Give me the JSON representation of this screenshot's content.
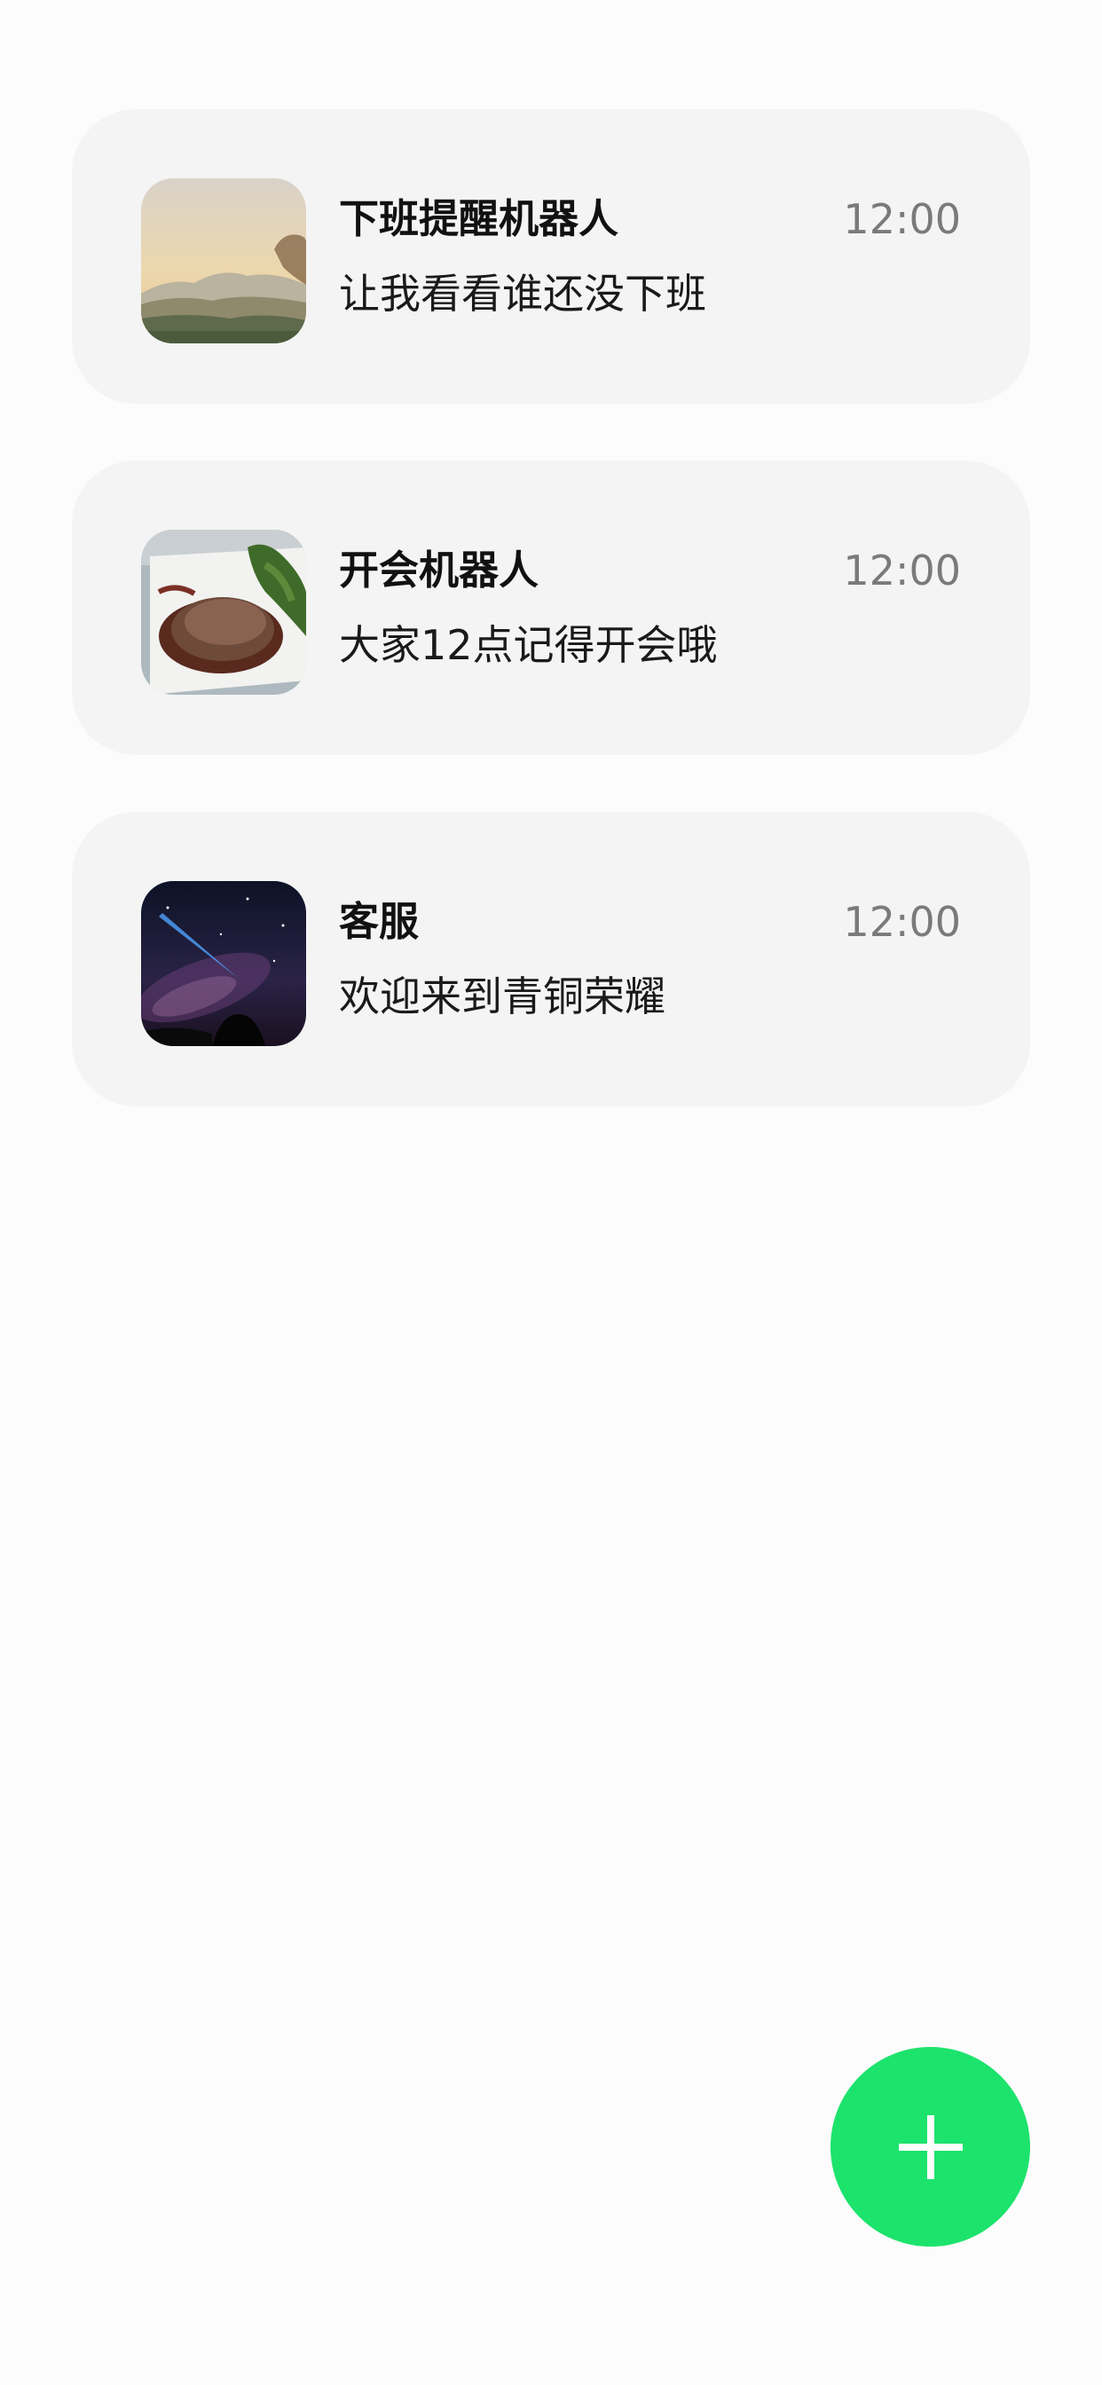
{
  "conversations": [
    {
      "title": "下班提醒机器人",
      "time": "12:00",
      "message": "让我看看谁还没下班",
      "avatar": "landscape-photo-avatar"
    },
    {
      "title": "开会机器人",
      "time": "12:00",
      "message": "大家12点记得开会哦",
      "avatar": "steak-dinner-photo-avatar"
    },
    {
      "title": "客服",
      "time": "12:00",
      "message": "欢迎来到青铜荣耀",
      "avatar": "night-sky-photo-avatar"
    }
  ],
  "fab": {
    "icon": "plus-icon",
    "color": "#1ce36c"
  }
}
